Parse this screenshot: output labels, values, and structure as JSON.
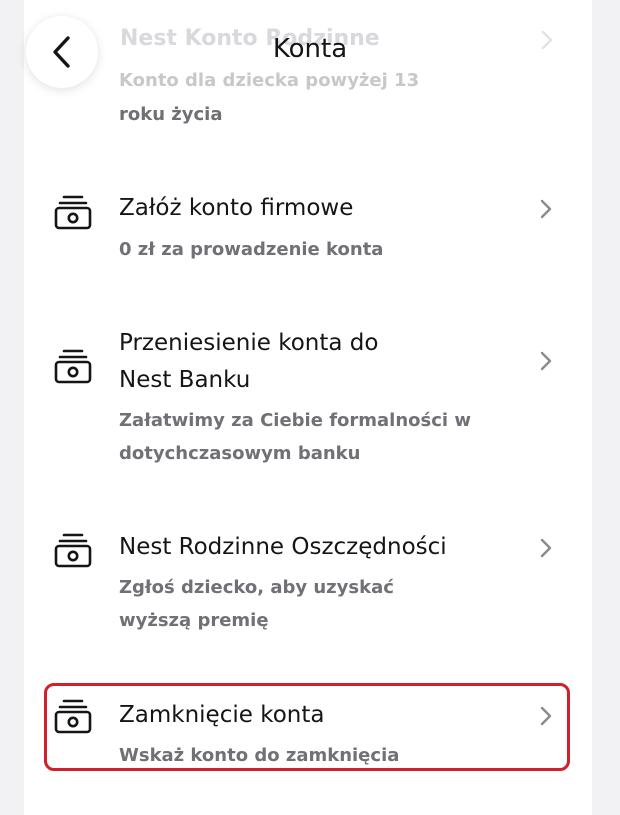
{
  "header": {
    "title": "Konta",
    "back_label": "back"
  },
  "ghost_item": {
    "title": "Nest Konto Rodzinne",
    "subtitle_line1": "Konto dla dziecka powyżej 13",
    "subtitle_line2": "roku życia"
  },
  "items": [
    {
      "title_line1": "Załóż konto firmowe",
      "title_line2": "",
      "subtitle_line1": "0 zł za prowadzenie konta",
      "subtitle_line2": "",
      "icon": "cash-stack-icon"
    },
    {
      "title_line1": "Przeniesienie konta do",
      "title_line2": "Nest Banku",
      "subtitle_line1": "Załatwimy za Ciebie formalności w",
      "subtitle_line2": "dotychczasowym banku",
      "icon": "cash-stack-icon"
    },
    {
      "title_line1": "Nest Rodzinne Oszczędności",
      "title_line2": "",
      "subtitle_line1": "Zgłoś dziecko, aby uzyskać",
      "subtitle_line2": "wyższą premię",
      "icon": "cash-stack-icon"
    },
    {
      "title_line1": "Zamknięcie konta",
      "title_line2": "",
      "subtitle_line1": "Wskaż konto do zamknięcia",
      "subtitle_line2": "",
      "icon": "cash-stack-icon",
      "highlighted": true
    }
  ],
  "colors": {
    "highlight_border": "#d0202a",
    "text_primary": "#151515",
    "text_secondary": "#707076"
  }
}
